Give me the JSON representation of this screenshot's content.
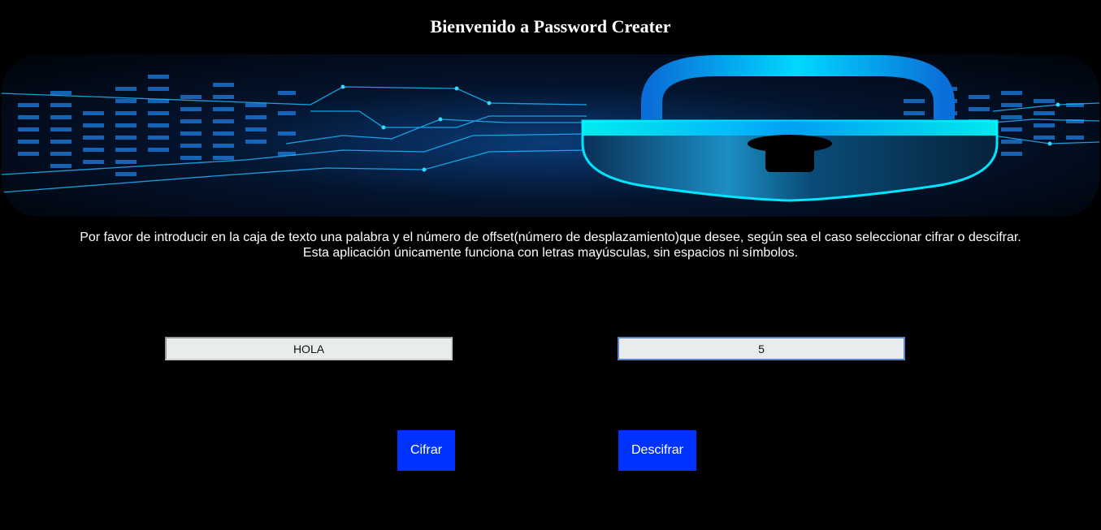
{
  "header": {
    "title": "Bienvenido a Password Creater"
  },
  "banner": {
    "icon": "padlock-icon",
    "colors": {
      "glow": "#00e5ff",
      "deep": "#04142e",
      "accent": "#1e90ff"
    }
  },
  "instructions": {
    "line1": "Por favor de introducir en la caja de texto una palabra y el número de offset(número de desplazamiento)que desee, según sea el caso seleccionar cifrar o descifrar.",
    "line2": "Esta aplicación únicamente funciona con letras mayúsculas, sin espacios ni símbolos."
  },
  "form": {
    "word_value": "HOLA",
    "offset_value": "5"
  },
  "actions": {
    "encrypt_label": "Cifrar",
    "decrypt_label": "Descifrar"
  },
  "colors": {
    "background": "#000000",
    "button": "#0033ff",
    "input_bg": "#e8ecec"
  }
}
